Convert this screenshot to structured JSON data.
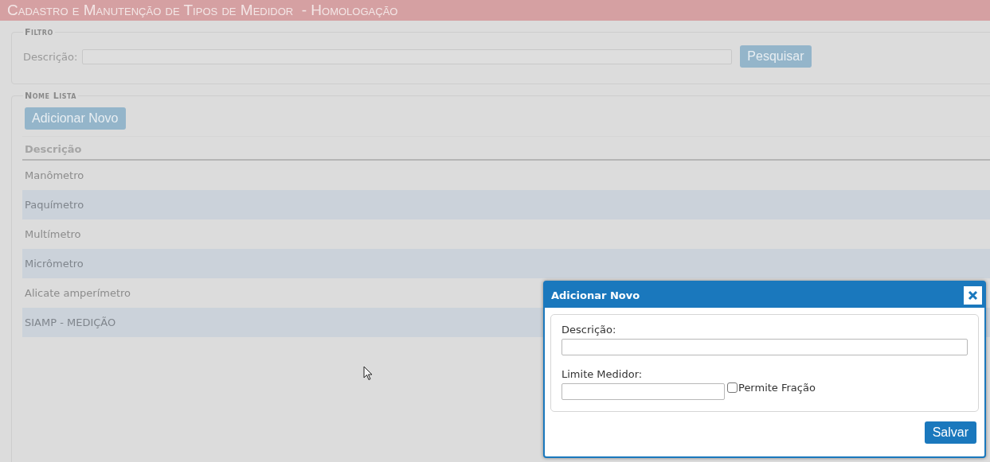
{
  "header": {
    "title": "Cadastro e Manutenção de Tipos de Medidor  - Homologação"
  },
  "filter": {
    "legend": "Filtro",
    "label": "Descrição:",
    "button": "Pesquisar"
  },
  "list": {
    "legend": "Nome Lista",
    "add_button": "Adicionar Novo",
    "columns": [
      "Descrição"
    ],
    "rows": [
      "Manômetro",
      "Paquímetro",
      "Multímetro",
      "Micrômetro",
      "Alicate amperímetro",
      "SIAMP - MEDIÇÃO"
    ]
  },
  "dialog": {
    "title": "Adicionar Novo",
    "description_label": "Descrição:",
    "limit_label": "Limite Medidor:",
    "fraction": {
      "label": "Permite Fração",
      "checked": false
    },
    "save_button": "Salvar"
  }
}
